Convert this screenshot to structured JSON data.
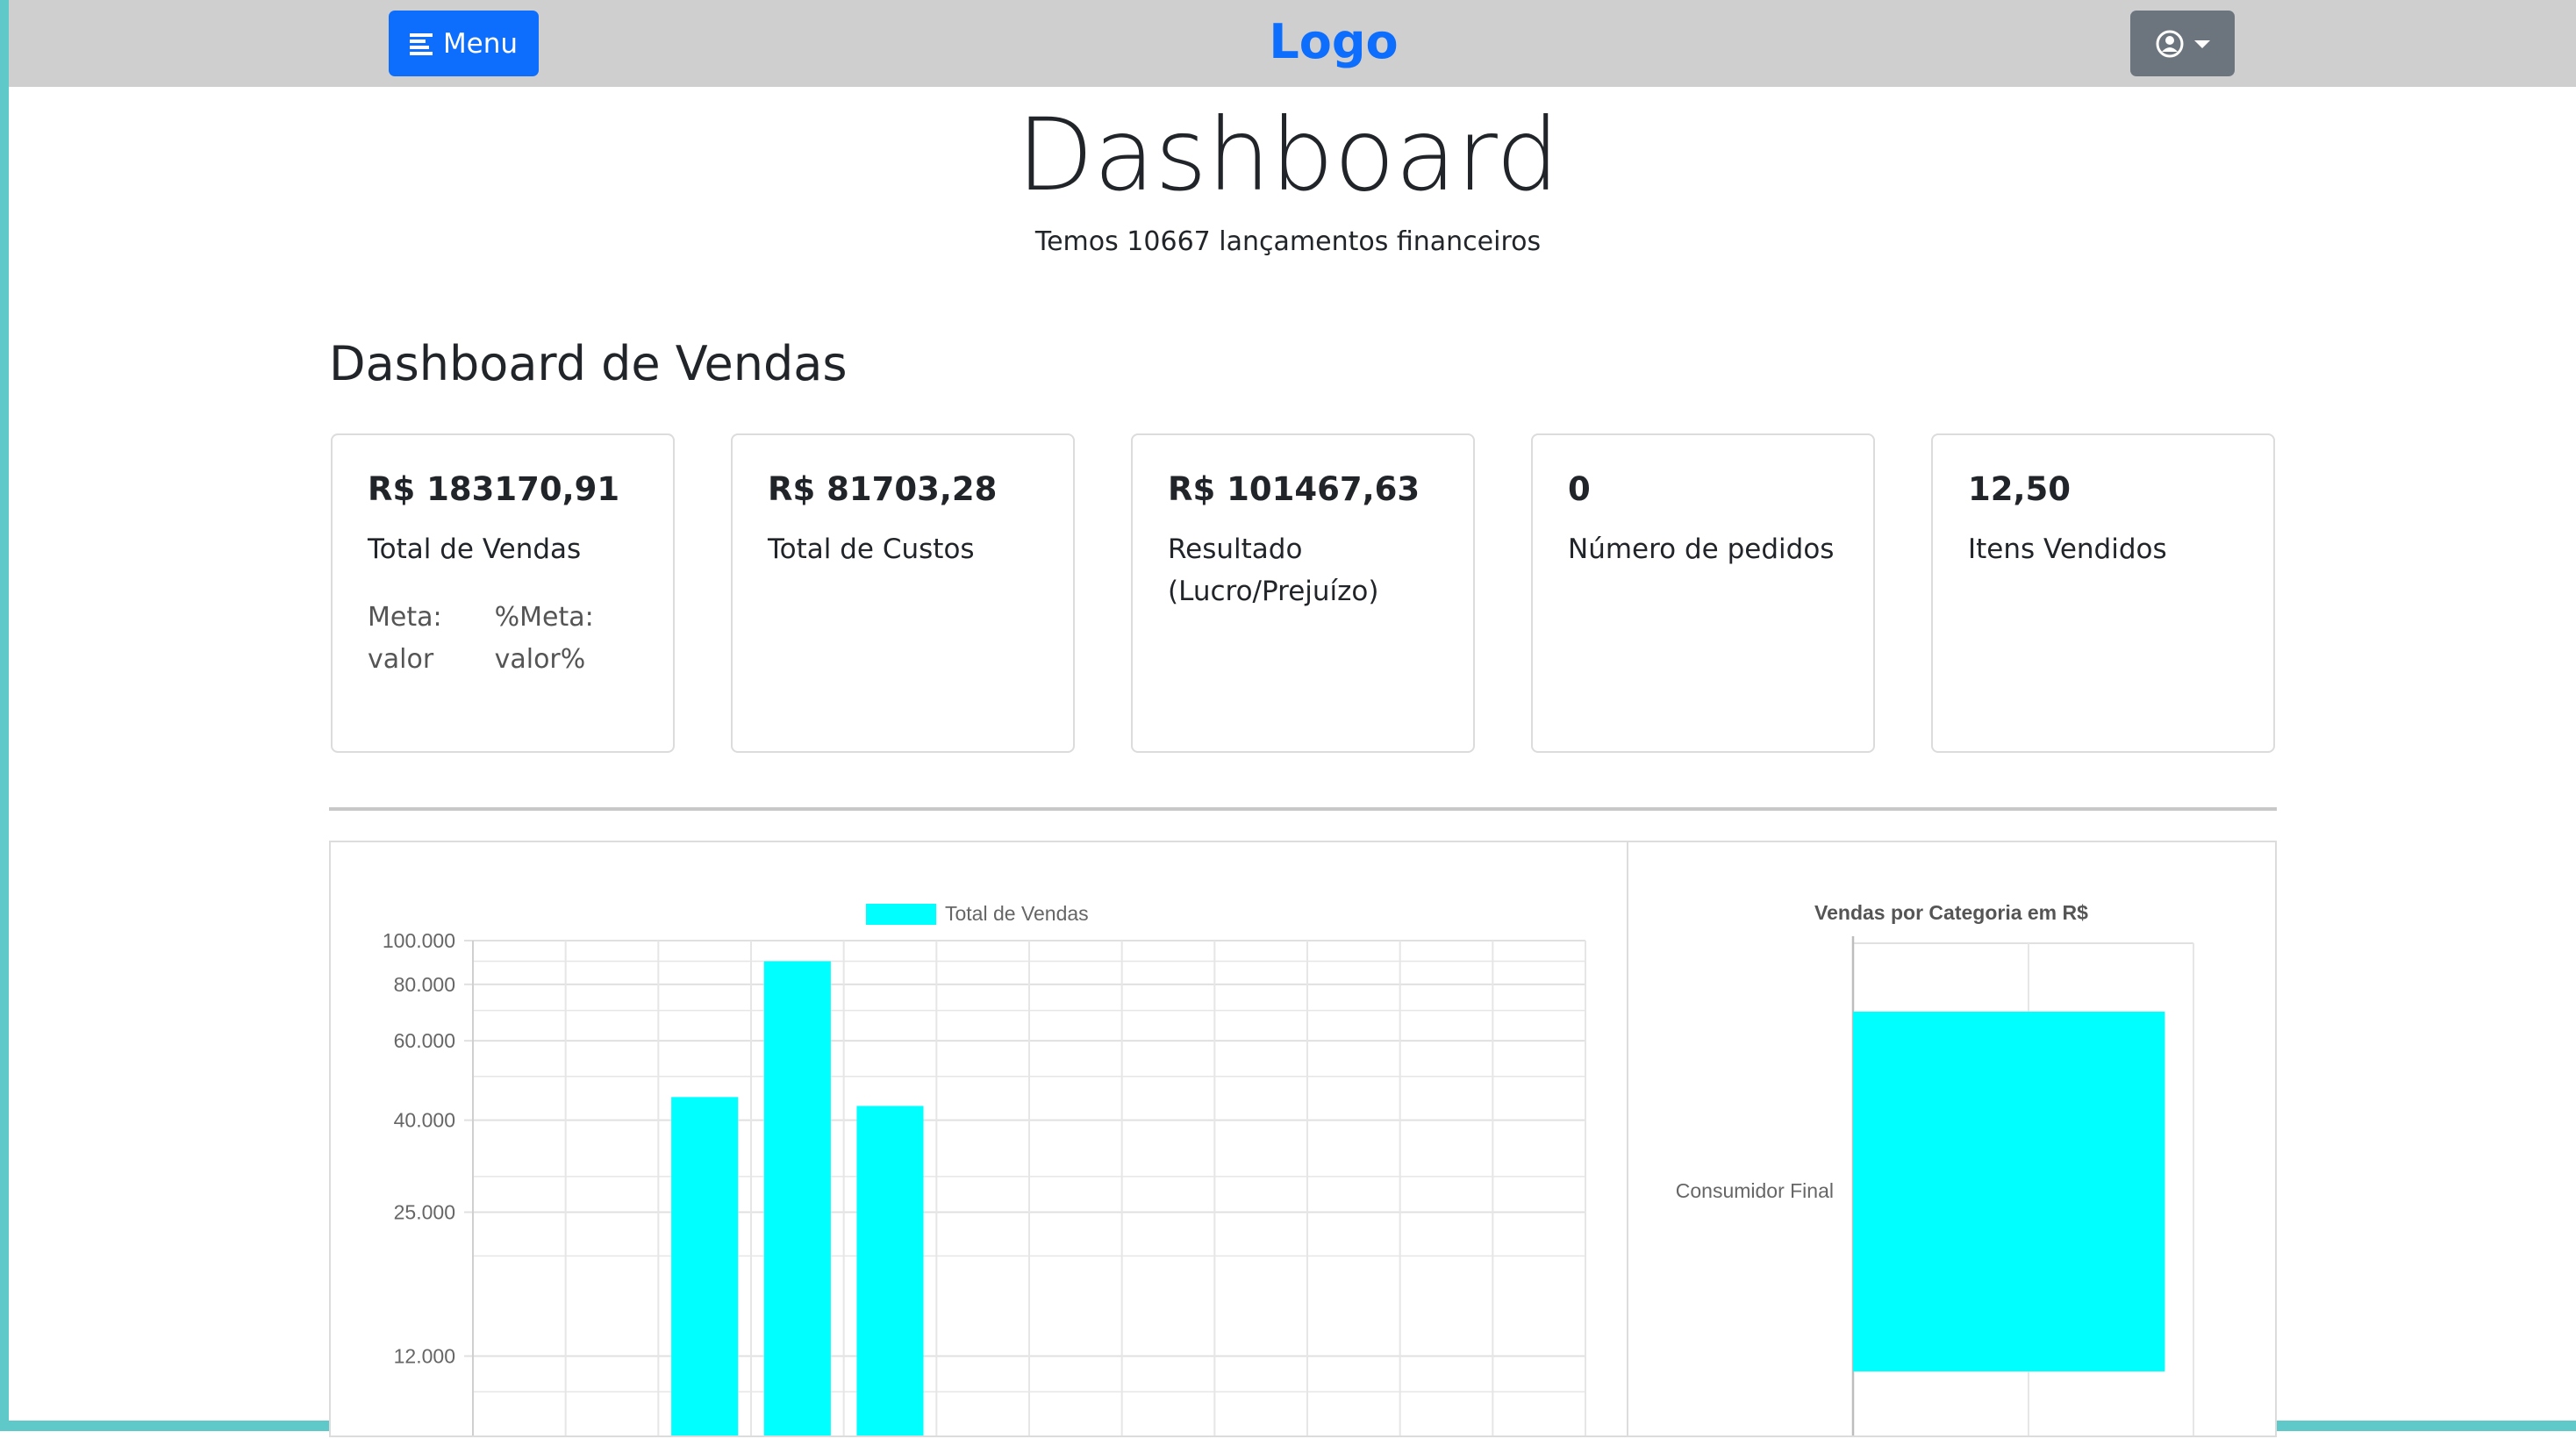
{
  "navbar": {
    "menu_label": "Menu",
    "logo": "Logo",
    "menu_icon": "hamburger-icon",
    "user_icon": "user-circle-icon",
    "dropdown_icon": "caret-down-icon"
  },
  "page": {
    "title": "Dashboard",
    "subtitle": "Temos 10667 lançamentos financeiros",
    "section_title": "Dashboard de Vendas"
  },
  "cards": [
    {
      "value": "R$ 183170,91",
      "label": "Total de Vendas",
      "meta_label": "Meta:",
      "meta_value": "valor",
      "pmeta_label": "%Meta:",
      "pmeta_value": "valor%"
    },
    {
      "value": "R$ 81703,28",
      "label": "Total de Custos"
    },
    {
      "value": "R$ 101467,63",
      "label": "Resultado (Lucro/Prejuízo)"
    },
    {
      "value": "0",
      "label": "Número de pedidos"
    },
    {
      "value": "12,50",
      "label": "Itens Vendidos"
    }
  ],
  "colors": {
    "primary": "#0d6efd",
    "bar": "#00ffff",
    "navbar": "#cfcfcf",
    "frame": "#5fc8c8",
    "user_button": "#6c757d"
  },
  "chart_data": [
    {
      "type": "bar",
      "legend": [
        "Total de Vendas"
      ],
      "y_scale": "log",
      "y_ticks": [
        "100.000",
        "80.000",
        "60.000",
        "40.000",
        "25.000",
        "12.000"
      ],
      "categories": [
        "",
        "",
        "",
        "",
        "",
        "",
        "",
        "",
        "",
        "",
        "",
        ""
      ],
      "series": [
        {
          "name": "Total de Vendas",
          "values": [
            null,
            null,
            45000,
            90000,
            43000,
            null,
            null,
            null,
            null,
            null,
            null,
            null
          ]
        }
      ]
    },
    {
      "type": "bar",
      "orientation": "horizontal",
      "title": "Vendas por Categoria em R$",
      "categories": [
        "Consumidor Final"
      ],
      "series": [
        {
          "name": "",
          "values": [
            183170.91
          ]
        }
      ],
      "xlim": [
        0,
        200000
      ]
    }
  ]
}
